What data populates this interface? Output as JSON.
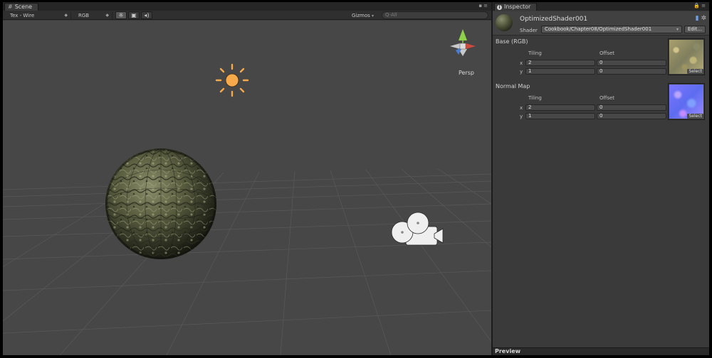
{
  "scene": {
    "tab_title": "Scene",
    "draw_mode": "Tex - Wire",
    "render_mode": "RGB",
    "gizmos_label": "Gizmos",
    "search_placeholder": "Q-All",
    "persp_label": "Persp",
    "icons": [
      "grid-icon",
      "sun-lighting-icon",
      "image-icon",
      "audio-icon",
      "sun-icon",
      "camera-icon",
      "orientation-gizmo"
    ]
  },
  "inspector": {
    "tab_title": "Inspector",
    "material_name": "OptimizedShader001",
    "shader_label": "Shader",
    "shader_value": "Cookbook/Chapter08/OptimizedShader001",
    "edit_label": "Edit...",
    "properties": [
      {
        "label": "Base (RGB)",
        "tiling_label": "Tiling",
        "offset_label": "Offset",
        "x_label": "x",
        "y_label": "y",
        "tiling_x": "2",
        "tiling_y": "1",
        "offset_x": "0",
        "offset_y": "0",
        "select_label": "Select"
      },
      {
        "label": "Normal Map",
        "tiling_label": "Tiling",
        "offset_label": "Offset",
        "x_label": "x",
        "y_label": "y",
        "tiling_x": "2",
        "tiling_y": "1",
        "offset_x": "0",
        "offset_y": "0",
        "select_label": "Select"
      }
    ],
    "preview_label": "Preview"
  },
  "colors": {
    "viewport_bg": "#474747",
    "panel_bg": "#3a3a3a",
    "sun_color": "#f6a94a",
    "gizmo_y": "#8ed049",
    "gizmo_x": "#d04a3e",
    "gizmo_z": "#4a7bd0"
  }
}
